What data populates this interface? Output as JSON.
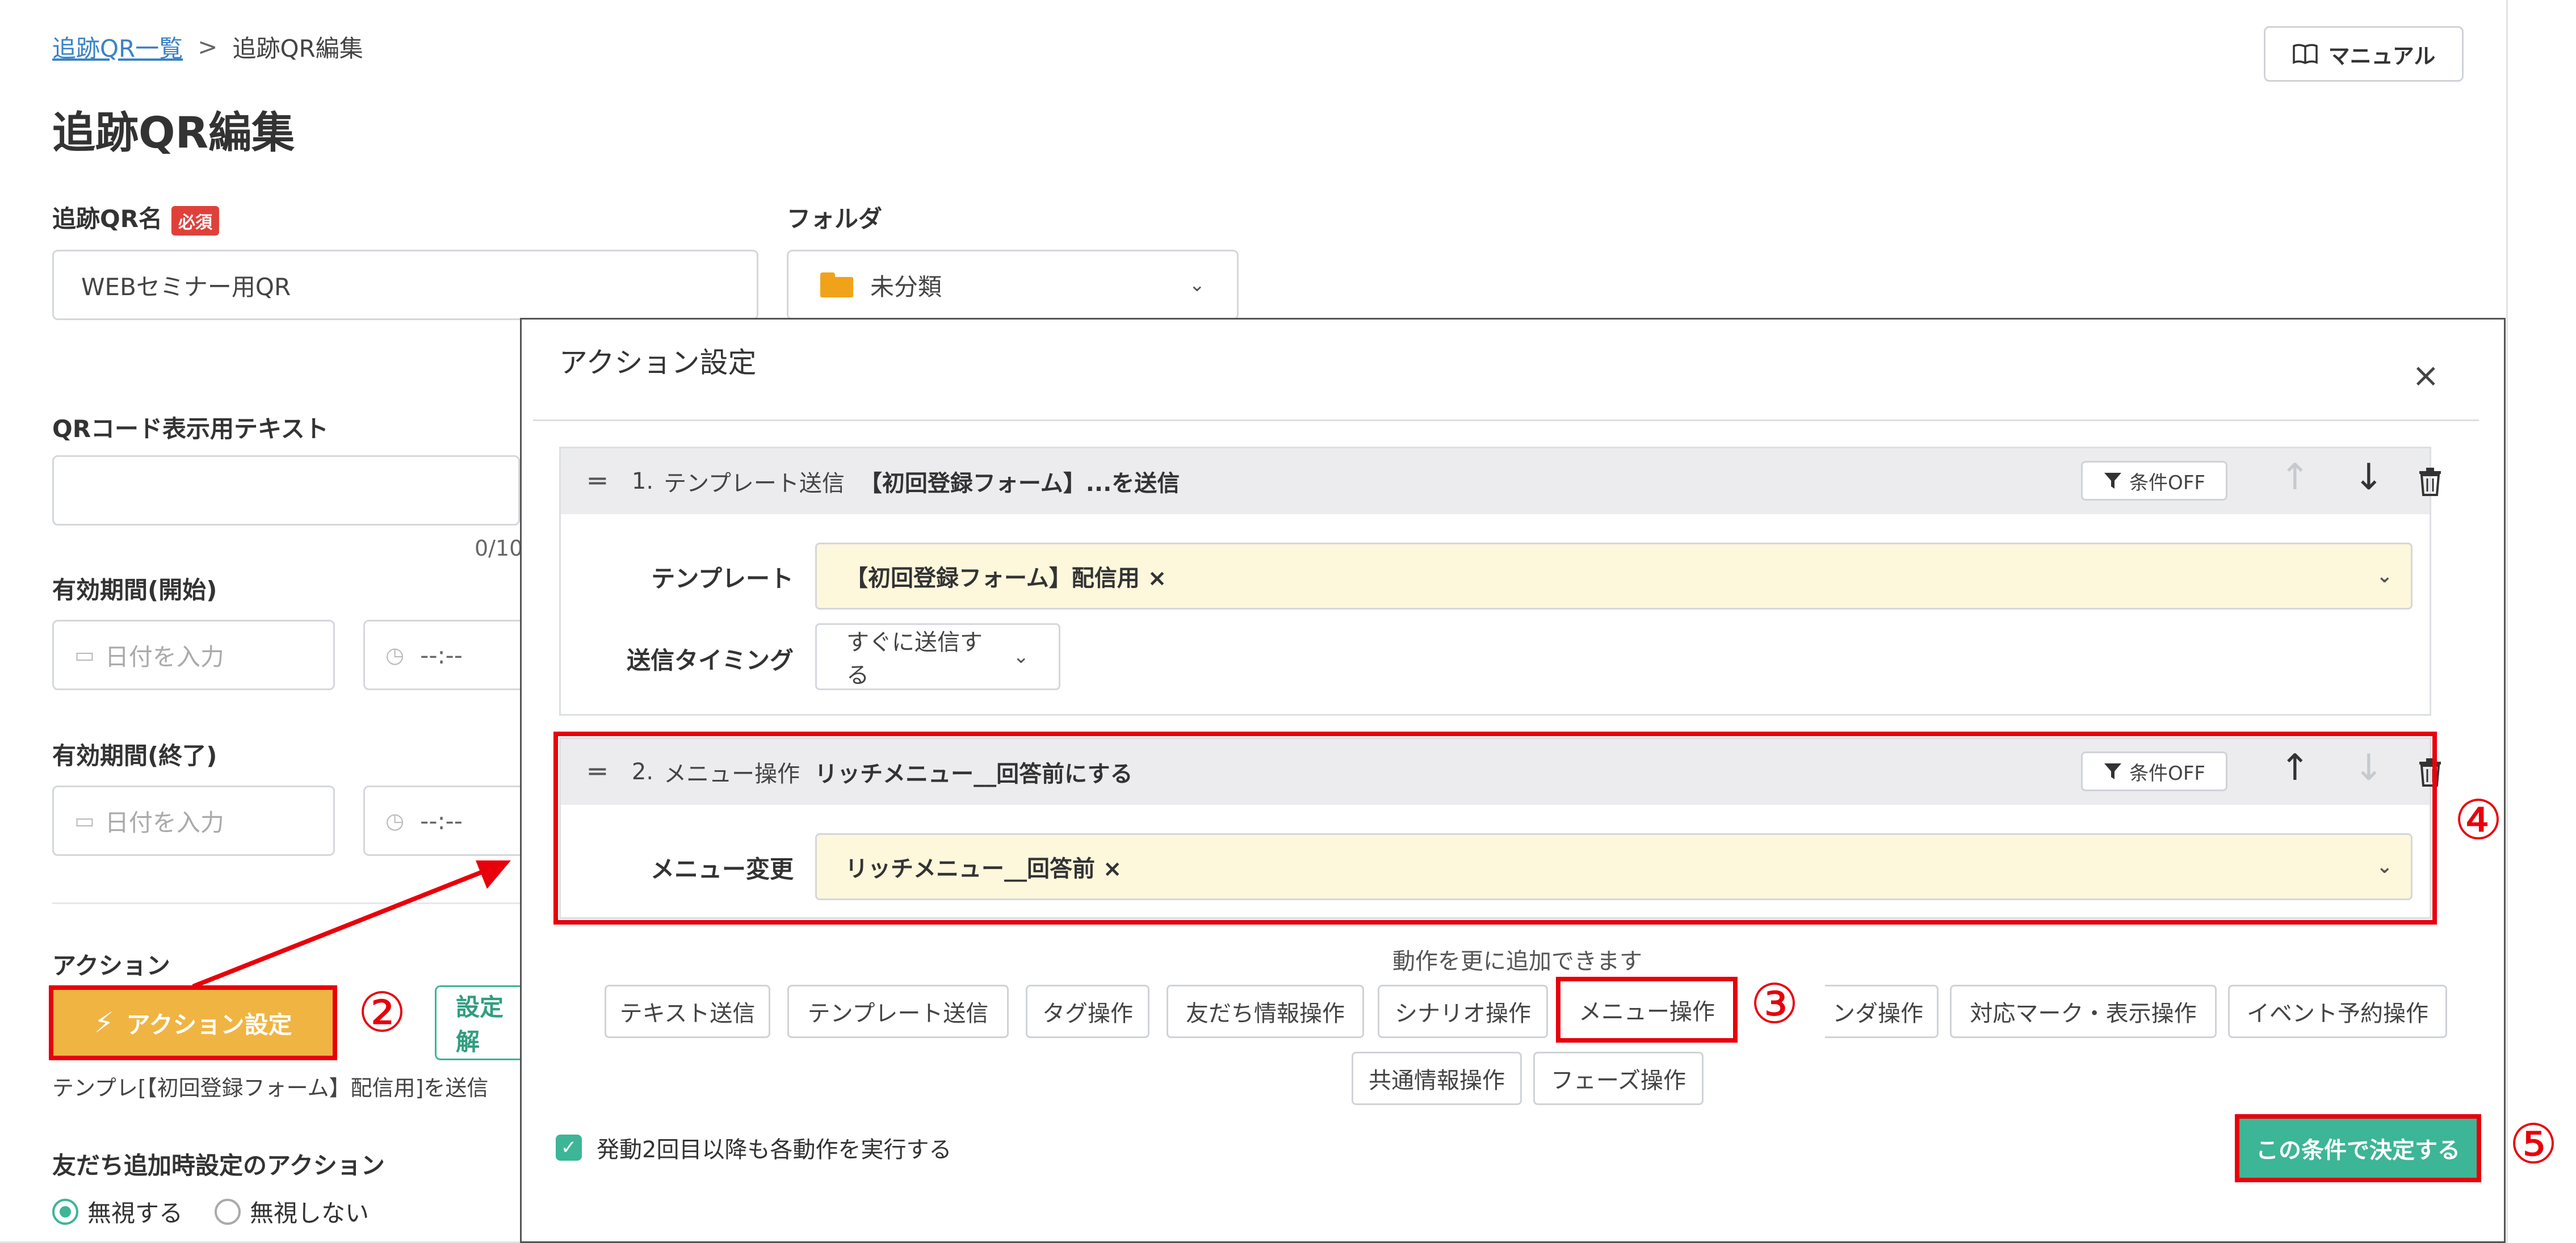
{
  "breadcrumb": {
    "parent": "追跡QR一覧",
    "separator": ">",
    "current": "追跡QR編集"
  },
  "header": {
    "title": "追跡QR編集",
    "manual_label": "マニュアル"
  },
  "form": {
    "qr_name_label": "追跡QR名",
    "required_badge": "必須",
    "qr_name_value": "WEBセミナー用QR",
    "folder_label": "フォルダ",
    "folder_value": "未分類",
    "qr_text_label": "QRコード表示用テキスト",
    "qr_text_value": "",
    "qr_text_count": "0/10",
    "start_label": "有効期間(開始)",
    "end_label": "有効期間(終了)",
    "date_placeholder": "日付を入力",
    "time_placeholder": "--:--",
    "action_label": "アクション",
    "action_button": "アクション設定",
    "unset_button": "設定解",
    "action_summary": "テンプレ[【初回登録フォーム】配信用]を送信",
    "friend_add_label": "友だち追加時設定のアクション",
    "radio_ignore": "無視する",
    "radio_not_ignore": "無視しない"
  },
  "modal": {
    "title": "アクション設定",
    "close": "×",
    "condition_off": "条件OFF",
    "steps": [
      {
        "number": "1.",
        "type": "テンプレート送信",
        "summary": "【初回登録フォーム】...を送信",
        "rows": [
          {
            "label": "テンプレート",
            "value": "【初回登録フォーム】配信用 ×"
          },
          {
            "label": "送信タイミング",
            "value": "すぐに送信する"
          }
        ]
      },
      {
        "number": "2.",
        "type": "メニュー操作",
        "summary": "リッチメニュー__回答前にする",
        "rows": [
          {
            "label": "メニュー変更",
            "value": "リッチメニュー__回答前 ×"
          }
        ]
      }
    ],
    "add_hint": "動作を更に追加できます",
    "add_buttons_row1": [
      "テキスト送信",
      "テンプレート送信",
      "タグ操作",
      "友だち情報操作",
      "シナリオ操作",
      "メニュー操作",
      "ンダ操作",
      "対応マーク・表示操作",
      "イベント予約操作"
    ],
    "add_buttons_row2": [
      "共通情報操作",
      "フェーズ操作"
    ],
    "repeat_checkbox": "発動2回目以降も各動作を実行する",
    "confirm_button": "この条件で決定する"
  },
  "annotations": {
    "n2": "②",
    "n3": "③",
    "n4": "④",
    "n5": "⑤"
  },
  "colors": {
    "accent_green": "#3db597",
    "annotation_red": "#e8000b",
    "action_orange": "#f0b443",
    "link_blue": "#3b82c4"
  }
}
